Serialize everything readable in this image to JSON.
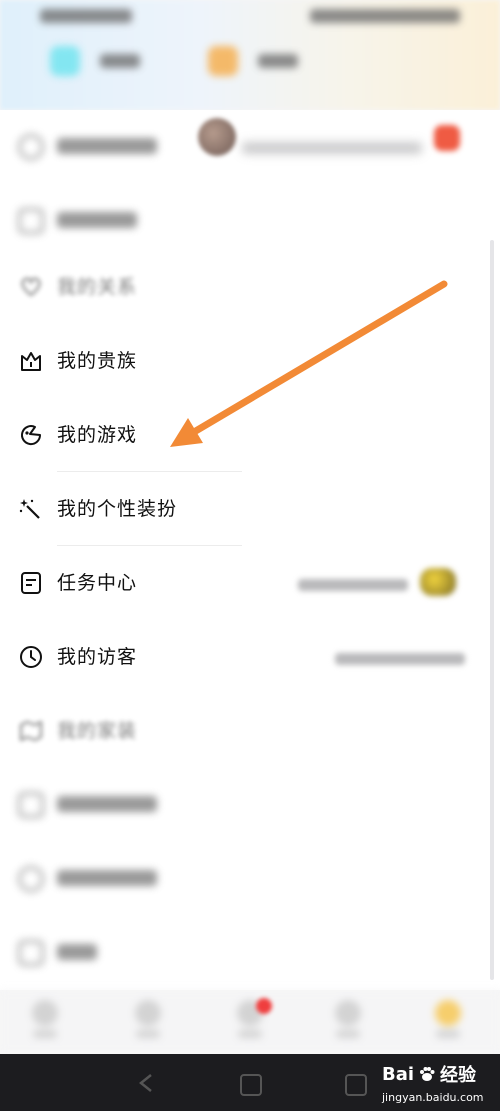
{
  "menu": {
    "items": [
      {
        "label": "我的贵族",
        "icon": "crown-icon"
      },
      {
        "label": "我的游戏",
        "icon": "game-icon"
      },
      {
        "label": "我的个性装扮",
        "icon": "magic-wand-icon"
      },
      {
        "label": "任务中心",
        "icon": "task-icon"
      },
      {
        "label": "我的访客",
        "icon": "clock-icon"
      }
    ],
    "blurred_items": [
      {
        "label": "我的关系",
        "icon": "heart-outline-icon"
      },
      {
        "label": "我的家装",
        "icon": "map-icon"
      }
    ]
  },
  "annotation": {
    "arrow_color": "#F28A36",
    "points_to": "我的游戏"
  },
  "watermark": {
    "brand": "Bai",
    "brand_suffix": "经验",
    "url": "jingyan.baidu.com"
  },
  "colors": {
    "accent_orange": "#F28A36",
    "badge_red": "#EF5B43",
    "panel_bg": "#FFFFFF",
    "system_nav": "#1C1C1F"
  }
}
